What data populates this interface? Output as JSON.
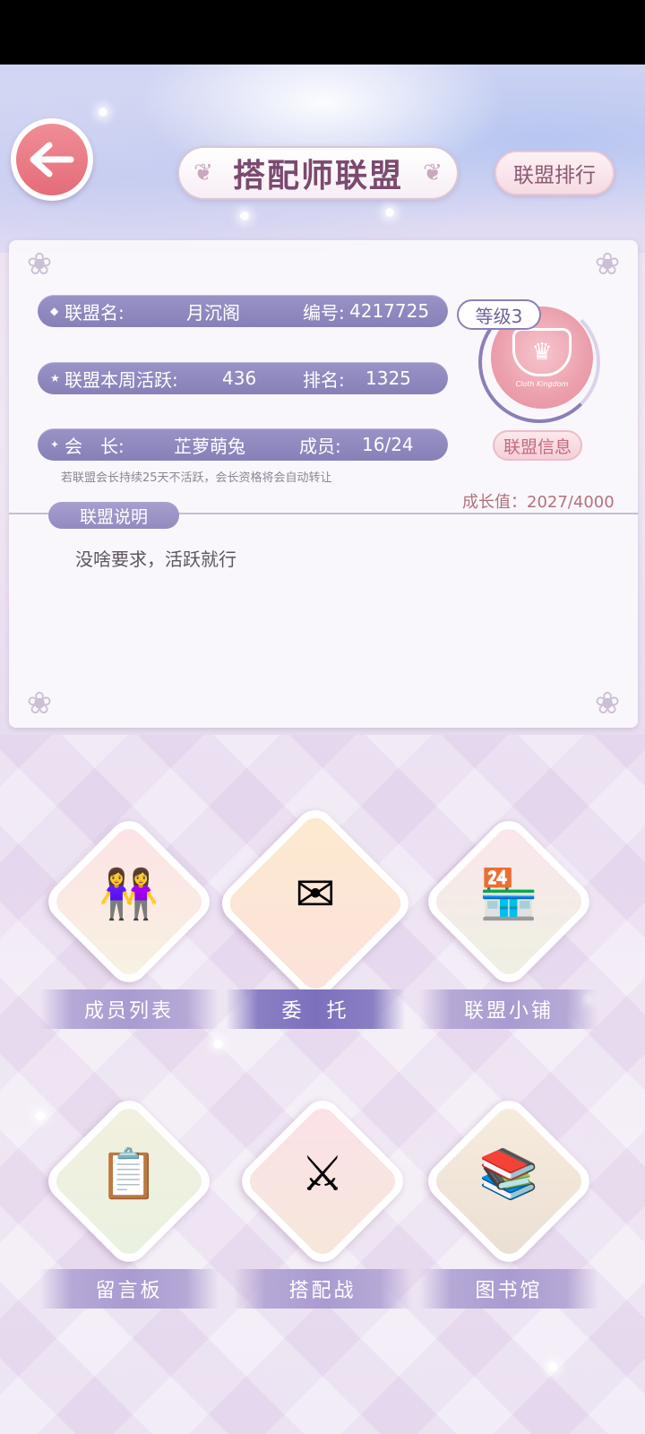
{
  "header": {
    "title": "搭配师联盟",
    "rank_button": "联盟排行"
  },
  "alliance": {
    "name_label": "联盟名:",
    "name": "月沉阁",
    "id_label": "编号:",
    "id": "4217725",
    "activity_label": "联盟本周活跃:",
    "activity": "436",
    "rank_label": "排名:",
    "rank": "1325",
    "leader_label": "会　长:",
    "leader": "芷萝萌兔",
    "members_label": "成员:",
    "members": "16/24",
    "level": "等级3",
    "badge_motto": "Cloth Kingdom",
    "info_button": "联盟信息",
    "notice": "若联盟会长持续25天不活跃，会长资格将会自动转让",
    "growth_label": "成长值：",
    "growth": "2027/4000",
    "description_tag": "联盟说明",
    "description": "没啥要求，活跃就行"
  },
  "features": [
    {
      "label": "成员列表",
      "icon": "members-icon"
    },
    {
      "label": "委　托",
      "icon": "commission-icon"
    },
    {
      "label": "联盟小铺",
      "icon": "shop-icon"
    },
    {
      "label": "留言板",
      "icon": "message-board-icon"
    },
    {
      "label": "搭配战",
      "icon": "battle-icon"
    },
    {
      "label": "图书馆",
      "icon": "library-icon"
    }
  ],
  "colors": {
    "accent": "#8780b8",
    "back_button": "#e56c79",
    "title": "#7b4a6f"
  }
}
